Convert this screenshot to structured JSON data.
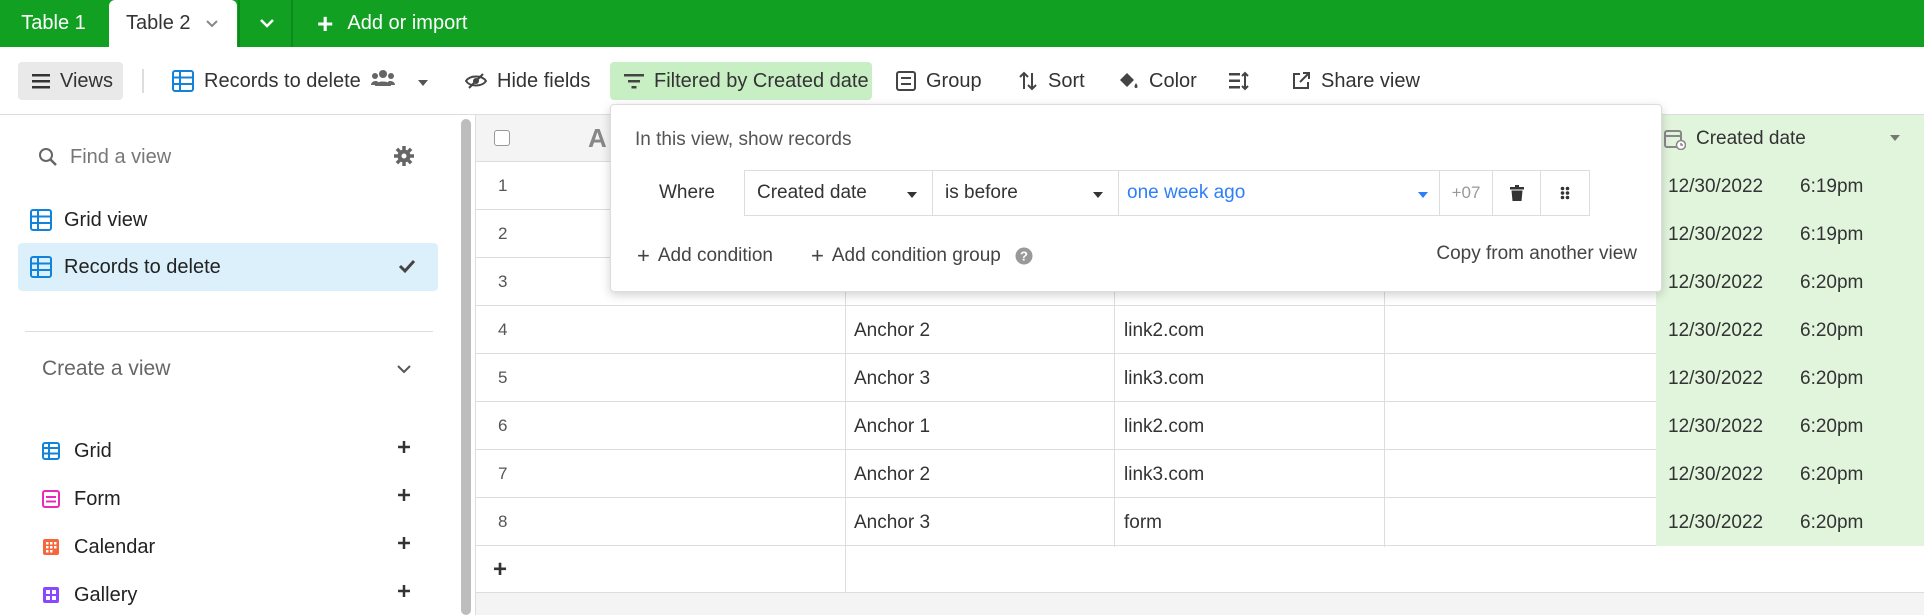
{
  "tabs": {
    "tab1": "Table 1",
    "tab2": "Table 2",
    "add_import": "Add or import"
  },
  "toolbar": {
    "views": "Views",
    "view_name": "Records to delete",
    "hide_fields": "Hide fields",
    "filter": "Filtered by Created date",
    "group": "Group",
    "sort": "Sort",
    "color": "Color",
    "share": "Share view"
  },
  "sidebar": {
    "search_placeholder": "Find a view",
    "views": [
      {
        "label": "Grid view",
        "selected": false
      },
      {
        "label": "Records to delete",
        "selected": true
      }
    ],
    "create_title": "Create a view",
    "create_items": [
      {
        "label": "Grid",
        "icon": "grid-icon",
        "color": "#1283da"
      },
      {
        "label": "Form",
        "icon": "form-icon",
        "color": "#e929ba"
      },
      {
        "label": "Calendar",
        "icon": "calendar-icon",
        "color": "#f7653b"
      },
      {
        "label": "Gallery",
        "icon": "gallery-icon",
        "color": "#8b46ff"
      }
    ]
  },
  "grid": {
    "primary_header_glyph": "A",
    "created_header": "Created date",
    "rows": [
      {
        "num": "1",
        "anchor": "",
        "link": "",
        "date": "12/30/2022",
        "time": "6:19pm"
      },
      {
        "num": "2",
        "anchor": "",
        "link": "",
        "date": "12/30/2022",
        "time": "6:19pm"
      },
      {
        "num": "3",
        "anchor": "",
        "link": "",
        "date": "12/30/2022",
        "time": "6:20pm"
      },
      {
        "num": "4",
        "anchor": "Anchor 2",
        "link": "link2.com",
        "date": "12/30/2022",
        "time": "6:20pm"
      },
      {
        "num": "5",
        "anchor": "Anchor 3",
        "link": "link3.com",
        "date": "12/30/2022",
        "time": "6:20pm"
      },
      {
        "num": "6",
        "anchor": "Anchor 1",
        "link": "link2.com",
        "date": "12/30/2022",
        "time": "6:20pm"
      },
      {
        "num": "7",
        "anchor": "Anchor 2",
        "link": "link3.com",
        "date": "12/30/2022",
        "time": "6:20pm"
      },
      {
        "num": "8",
        "anchor": "Anchor 3",
        "link": "form",
        "date": "12/30/2022",
        "time": "6:20pm"
      }
    ]
  },
  "filter_popover": {
    "title": "In this view, show records",
    "where": "Where",
    "field": "Created date",
    "operator": "is before",
    "value": "one week ago",
    "timezone": "+07",
    "add_condition": "Add condition",
    "add_condition_group": "Add condition group",
    "copy_from": "Copy from another view"
  },
  "colors": {
    "brand_green": "#11a022",
    "filter_active_bg": "#c8efc4",
    "selected_view_bg": "#dcf0fb",
    "date_column_bg": "#e1f4dc",
    "link_blue": "#2d7ff9"
  }
}
